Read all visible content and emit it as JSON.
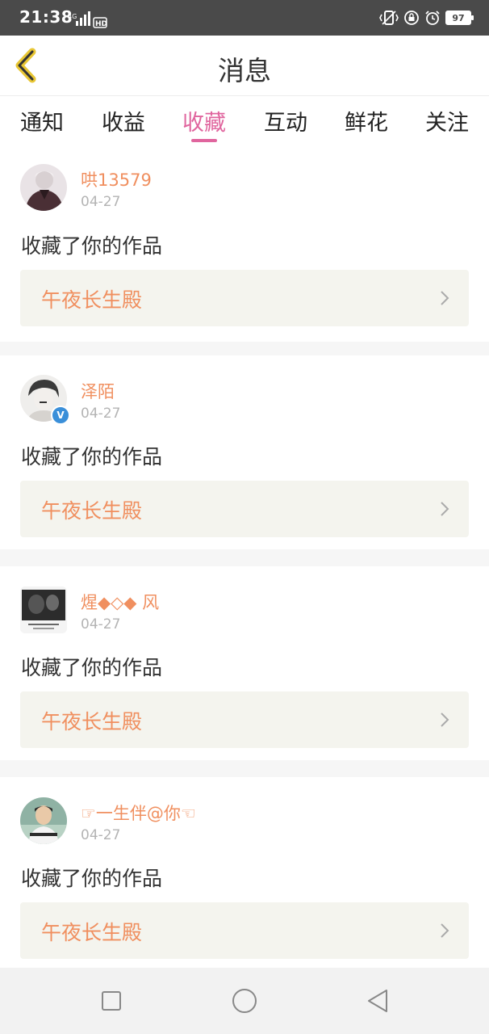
{
  "status_bar": {
    "time": "21:38",
    "network_label": "4G",
    "hd_label": "HD",
    "battery": "97"
  },
  "header": {
    "title": "消息",
    "back_icon": "chevron-left-icon"
  },
  "tabs": [
    {
      "label": "通知",
      "active": false
    },
    {
      "label": "收益",
      "active": false
    },
    {
      "label": "收藏",
      "active": true
    },
    {
      "label": "互动",
      "active": false
    },
    {
      "label": "鲜花",
      "active": false
    },
    {
      "label": "关注",
      "active": false
    }
  ],
  "colors": {
    "accent": "#e0659e",
    "username": "#f08f5f",
    "work_title": "#f08f5f",
    "work_box_bg": "#f4f4ee"
  },
  "messages": [
    {
      "user": "哄13579",
      "date": "04-27",
      "action": "收藏了你的作品",
      "work": "午夜长生殿",
      "verified": false
    },
    {
      "user": "泽陌",
      "date": "04-27",
      "action": "收藏了你的作品",
      "work": "午夜长生殿",
      "verified": true
    },
    {
      "user": "煋◆◇◆ 风",
      "date": "04-27",
      "action": "收藏了你的作品",
      "work": "午夜长生殿",
      "verified": false
    },
    {
      "user": "☞一生伴@你☜",
      "date": "04-27",
      "action": "收藏了你的作品",
      "work": "午夜长生殿",
      "verified": false
    }
  ],
  "nav": {
    "recents_icon": "square-icon",
    "home_icon": "circle-icon",
    "back_icon": "triangle-back-icon"
  }
}
